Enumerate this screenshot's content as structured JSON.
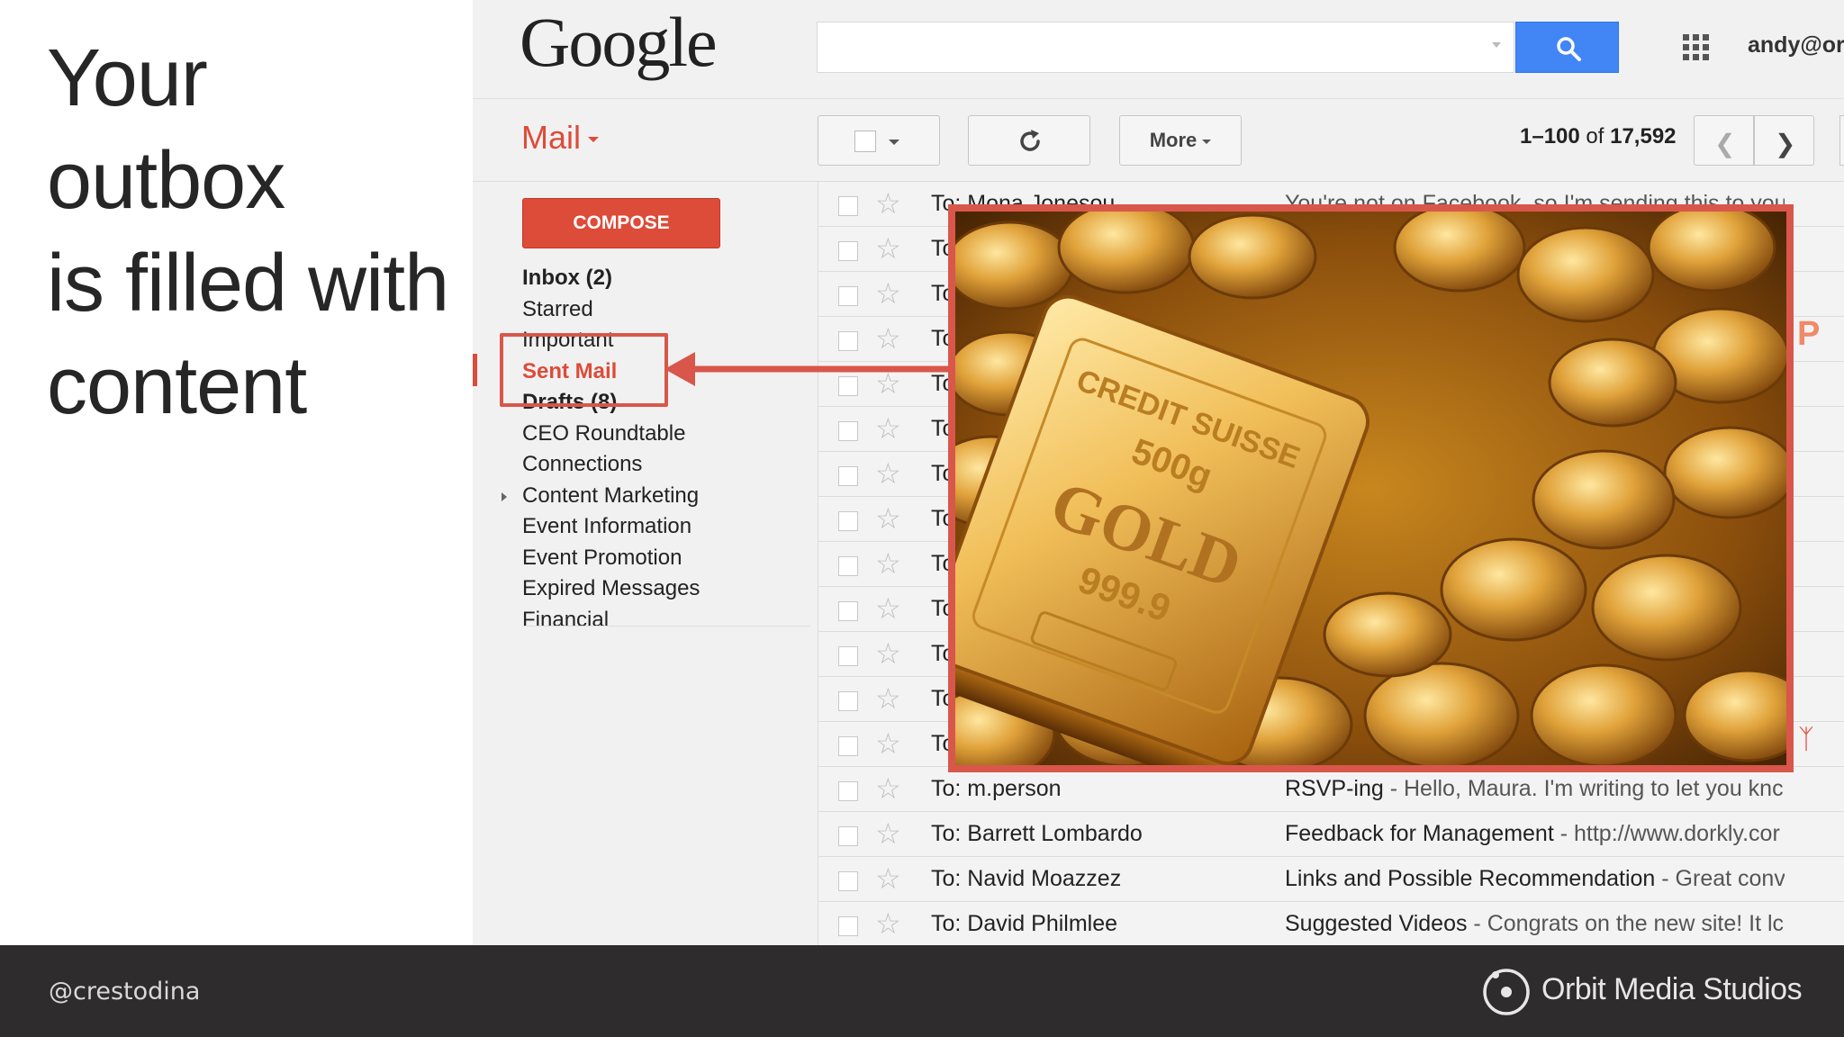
{
  "slide": {
    "title_lines": [
      "Your outbox",
      "is filled with",
      "content"
    ],
    "handle": "@crestodina",
    "brand": "Orbit Media Studios"
  },
  "gmail": {
    "logo": "Google",
    "account": "andy@or",
    "mail_label": "Mail",
    "compose_label": "COMPOSE",
    "more_label": "More",
    "pager": {
      "range": "1–100",
      "of": "of",
      "total": "17,592"
    },
    "nav": [
      {
        "label": "Inbox (2)",
        "bold": true
      },
      {
        "label": "Starred"
      },
      {
        "label": "Important"
      },
      {
        "label": "Sent Mail",
        "active": true
      },
      {
        "label": "Drafts (8)",
        "bold": true
      },
      {
        "label": "CEO Roundtable"
      },
      {
        "label": "Connections"
      },
      {
        "label": "Content Marketing",
        "expandable": true
      },
      {
        "label": "Event Information"
      },
      {
        "label": "Event Promotion"
      },
      {
        "label": "Expired Messages"
      },
      {
        "label": "Financial"
      }
    ],
    "rows": [
      {
        "to": "To: Mona Jonesou",
        "subject": "",
        "snippet": "You're not on Facebook, so I'm sending this to you"
      },
      {
        "to": "To",
        "subject": "",
        "snippet": ""
      },
      {
        "to": "To",
        "subject": "",
        "snippet": ""
      },
      {
        "to": "To",
        "subject": "",
        "snippet": ""
      },
      {
        "to": "To",
        "subject": "",
        "snippet": ""
      },
      {
        "to": "To",
        "subject": "",
        "snippet": ""
      },
      {
        "to": "To",
        "subject": "",
        "snippet": ""
      },
      {
        "to": "To",
        "subject": "",
        "snippet": ""
      },
      {
        "to": "To",
        "subject": "",
        "snippet": ""
      },
      {
        "to": "To",
        "subject": "",
        "snippet": ""
      },
      {
        "to": "To",
        "subject": "",
        "snippet": ""
      },
      {
        "to": "To",
        "subject": "",
        "snippet": ""
      },
      {
        "to": "To",
        "subject": "",
        "snippet": ""
      },
      {
        "to": "To: m.person",
        "subject": "RSVP-ing",
        "snippet": " - Hello, Maura. I'm writing to let you knc"
      },
      {
        "to": "To: Barrett Lombardo",
        "subject": "Feedback for Management",
        "snippet": " - http://www.dorkly.cor"
      },
      {
        "to": "To: Navid Moazzez",
        "subject": "Links and Possible Recommendation",
        "snippet": " - Great conv"
      },
      {
        "to": "To: David Philmlee",
        "subject": "Suggested Videos",
        "snippet": " - Congrats on the new site! It lc"
      }
    ],
    "right_sliver_glyph": "P"
  },
  "photo": {
    "bar_text_top": "CREDIT SUISSE",
    "bar_weight": "500g",
    "bar_gold": "GOLD",
    "bar_purity": "999.9"
  },
  "colors": {
    "accent_red": "#dd4b39",
    "highlight_red": "#d8574a",
    "search_blue": "#4285f4",
    "footer_bg": "#2e2c2d"
  },
  "icons": [
    "search-icon",
    "apps-grid-icon",
    "refresh-icon",
    "chevron-left-icon",
    "chevron-right-icon",
    "star-icon",
    "pdf-icon",
    "orbit-logo-icon"
  ]
}
